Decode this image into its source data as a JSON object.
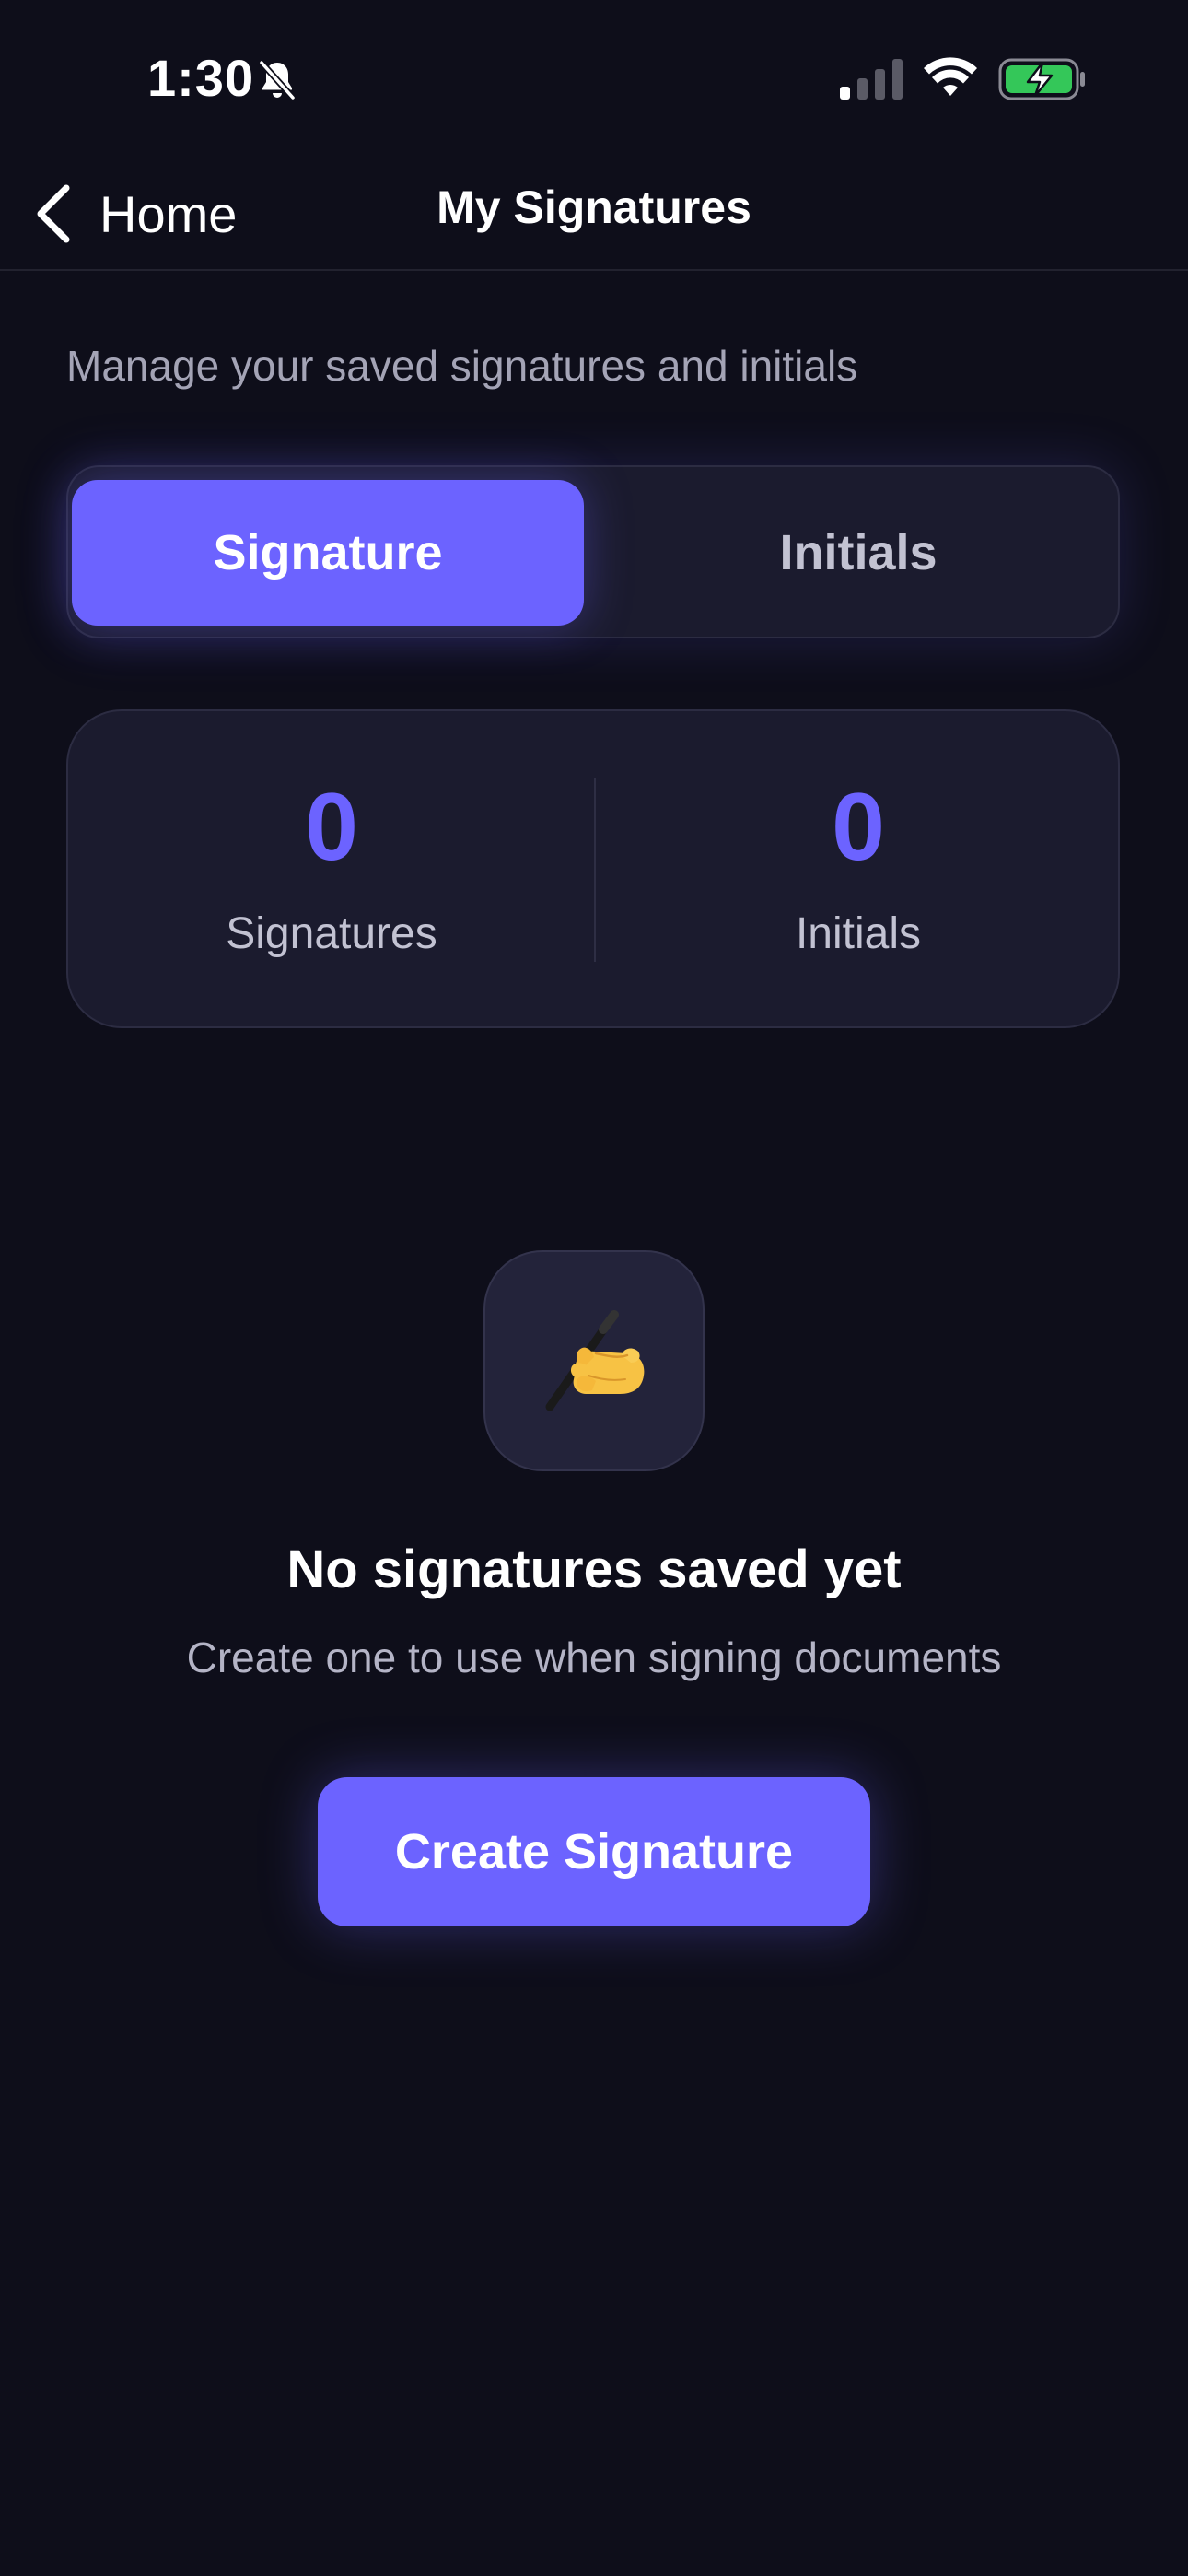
{
  "status_bar": {
    "time": "1:30",
    "icons": [
      "bell-off-icon",
      "signal-icon",
      "wifi-icon",
      "battery-charging-icon"
    ]
  },
  "nav": {
    "back_label": "Home",
    "title": "My Signatures"
  },
  "subtitle": "Manage your saved signatures and initials",
  "segmented_control": {
    "selected": "Signature",
    "options": [
      {
        "label": "Signature",
        "active": true
      },
      {
        "label": "Initials",
        "active": false
      }
    ]
  },
  "stats": [
    {
      "value": "0",
      "label": "Signatures"
    },
    {
      "value": "0",
      "label": "Initials"
    }
  ],
  "empty_state": {
    "icon": "writing-hand-icon",
    "title": "No signatures saved yet",
    "subtitle": "Create one to use when signing documents",
    "button_label": "Create Signature"
  },
  "colors": {
    "background": "#0e0e1a",
    "card": "#1b1b2e",
    "accent": "#6c63ff",
    "battery_green": "#34c759"
  }
}
